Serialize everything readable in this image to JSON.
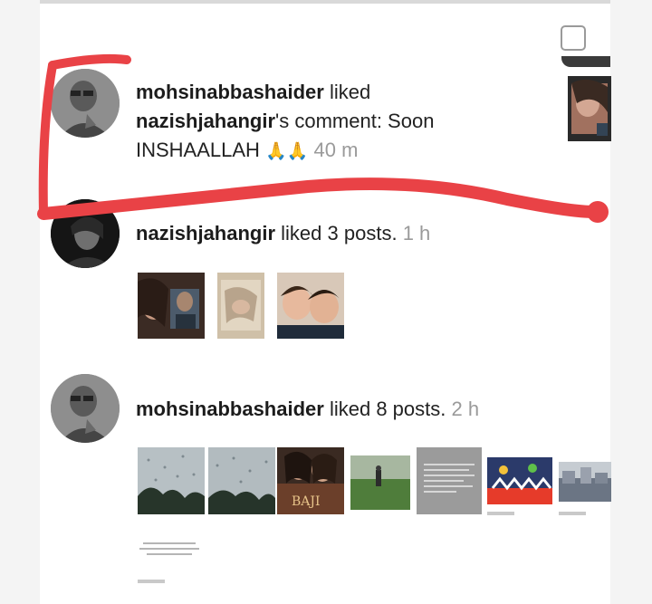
{
  "notifications": [
    {
      "user": "mohsinabbashaider",
      "verb": " liked",
      "target_user": "nazishjahangir",
      "target_suffix": "'s comment: Soon",
      "line3": "INSHAALLAH",
      "emoji": "🙏🙏",
      "time": "40 m"
    },
    {
      "user": "nazishjahangir",
      "verb": " liked 3 posts.",
      "time": "1 h",
      "thumbs": [
        "post-thumb-1",
        "post-thumb-2",
        "post-thumb-3"
      ]
    },
    {
      "user": "mohsinabbashaider",
      "verb": " liked 8 posts.",
      "time": "2 h",
      "thumbs": [
        "rain-window-1",
        "rain-window-2",
        "movie-poster",
        "cricket-field",
        "text-post",
        "cartoon-banner",
        "stadium",
        "text-card"
      ],
      "poster_text": "BAJI"
    }
  ],
  "colors": {
    "highlight": "#e94246",
    "background": "#f4f4f4",
    "panel": "#ffffff",
    "muted_text": "#9a9a9a"
  }
}
